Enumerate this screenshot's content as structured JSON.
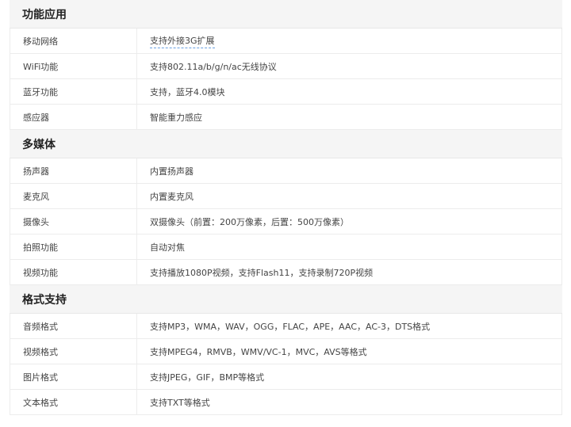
{
  "sections": [
    {
      "title": "功能应用",
      "rows": [
        {
          "label": "移动网络",
          "value": "支持外接3G扩展"
        },
        {
          "label": "WiFi功能",
          "value": "支持802.11a/b/g/n/ac无线协议"
        },
        {
          "label": "蓝牙功能",
          "value": "支持，蓝牙4.0模块"
        },
        {
          "label": "感应器",
          "value": "智能重力感应"
        }
      ]
    },
    {
      "title": "多媒体",
      "rows": [
        {
          "label": "扬声器",
          "value": "内置扬声器"
        },
        {
          "label": "麦克风",
          "value": "内置麦克风"
        },
        {
          "label": "摄像头",
          "value": "双摄像头（前置：200万像素，后置：500万像素）"
        },
        {
          "label": "拍照功能",
          "value": "自动对焦"
        },
        {
          "label": "视频功能",
          "value": "支持播放1080P视频，支持Flash11，支持录制720P视频"
        }
      ]
    },
    {
      "title": "格式支持",
      "rows": [
        {
          "label": "音频格式",
          "value": "支持MP3，WMA，WAV，OGG，FLAC，APE，AAC，AC-3，DTS格式"
        },
        {
          "label": "视频格式",
          "value": "支持MPEG4，RMVB，WMV/VC-1，MVC，AVS等格式"
        },
        {
          "label": "图片格式",
          "value": "支持JPEG，GIF，BMP等格式"
        },
        {
          "label": "文本格式",
          "value": "支持TXT等格式"
        }
      ]
    }
  ]
}
